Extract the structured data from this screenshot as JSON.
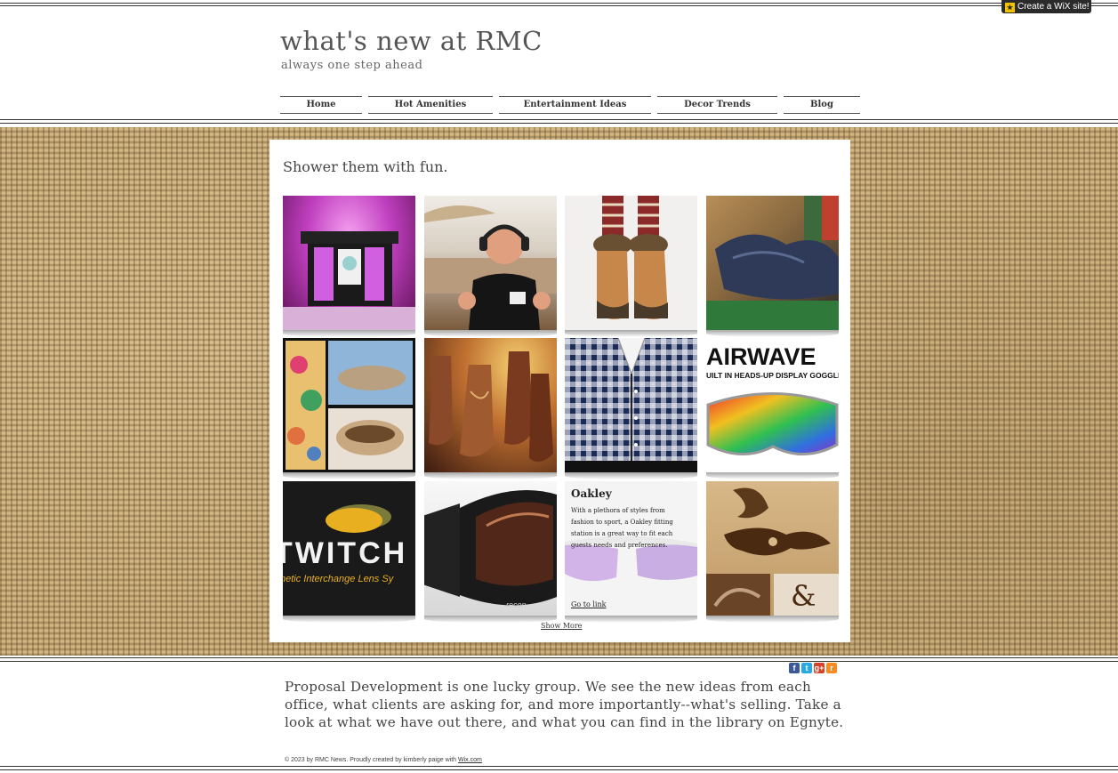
{
  "badge": {
    "label": "Create a WiX site!"
  },
  "header": {
    "title": "what's new at RMC",
    "tagline": "always one step ahead"
  },
  "nav": {
    "items": [
      {
        "label": "Home"
      },
      {
        "label": "Hot Amenities"
      },
      {
        "label": "Entertainment Ideas"
      },
      {
        "label": "Decor Trends"
      },
      {
        "label": "Blog"
      }
    ]
  },
  "gallery": {
    "title": "Shower them with fun.",
    "show_more": "Show More",
    "tiles": [
      {
        "subject": "lit DJ bar booth"
      },
      {
        "subject": "man with headphones thumbs up"
      },
      {
        "subject": "fur boots with patterned leggings"
      },
      {
        "subject": "jeans on green surface"
      },
      {
        "subject": "Maui Jim sunglasses collage"
      },
      {
        "subject": "cowboy boots"
      },
      {
        "subject": "blue gingham shirts"
      },
      {
        "subject": "Airwave goggles",
        "text_top": "AIRWAVE",
        "text_sub": "UILT IN HEADS-UP DISPLAY GOGGLE"
      },
      {
        "subject": "Twitch interchange lens",
        "text_main": "TWITCH",
        "text_sub": "netic Interchange Lens Sy"
      },
      {
        "subject": "recon ski goggles",
        "text_brand": "recon"
      },
      {
        "subject": "Oakley",
        "title": "Oakley",
        "description": "With a plethora of styles from fashion to sport, a Oakley fitting station is a great way to fit each guests needs and preferences.",
        "link": "Go to link"
      },
      {
        "subject": "engraved wood design"
      }
    ]
  },
  "social": [
    {
      "icon": "facebook-icon",
      "glyph": "f",
      "color": "#3b5998"
    },
    {
      "icon": "twitter-icon",
      "glyph": "t",
      "color": "#29a9e1"
    },
    {
      "icon": "google-plus-icon",
      "glyph": "g+",
      "color": "#d24228"
    },
    {
      "icon": "rss-icon",
      "glyph": "r",
      "color": "#f48c20"
    }
  ],
  "footer": {
    "text": "Proposal Development is one lucky group. We see the new ideas from each office, what clients are asking for, and more importantly--what's selling. Take a look at what we have out there, and what you can find in the library on Egnyte.",
    "copyright_prefix": "© 2023 by RMC News. Proudly created by kimberly paige with ",
    "copyright_link": "Wix.com"
  }
}
